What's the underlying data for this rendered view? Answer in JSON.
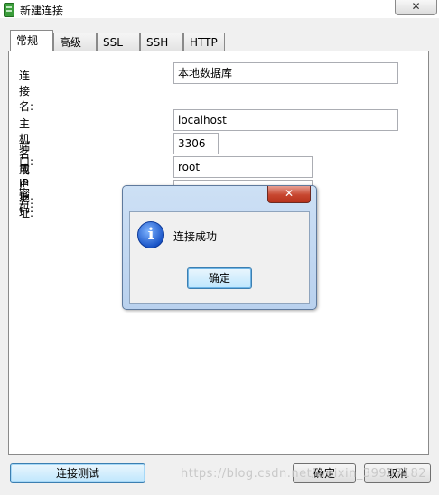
{
  "window": {
    "title": "新建连接",
    "close_glyph": "✕"
  },
  "tabs": [
    {
      "label": "常规",
      "active": true
    },
    {
      "label": "高级"
    },
    {
      "label": "SSL"
    },
    {
      "label": "SSH"
    },
    {
      "label": "HTTP"
    }
  ],
  "form": {
    "connection_name": {
      "label": "连接名:",
      "value": "本地数据库"
    },
    "host": {
      "label": "主机名或 IP 地址:",
      "value": "localhost"
    },
    "port": {
      "label": "端口:",
      "value": "3306"
    },
    "username": {
      "label": "用户名:",
      "value": "root"
    },
    "password": {
      "label": "密码:"
    }
  },
  "buttons": {
    "test": "连接测试",
    "ok": "确定",
    "cancel": "取消"
  },
  "watermark": "https://blog.csdn.net/weixin_39907182",
  "dialog": {
    "message": "连接成功",
    "ok": "确定",
    "close_glyph": "✕",
    "icon": "info-icon"
  },
  "colors": {
    "accent": "#3c7fb1",
    "dialog_frame": "#cde0f5",
    "close_red": "#c7462f"
  }
}
